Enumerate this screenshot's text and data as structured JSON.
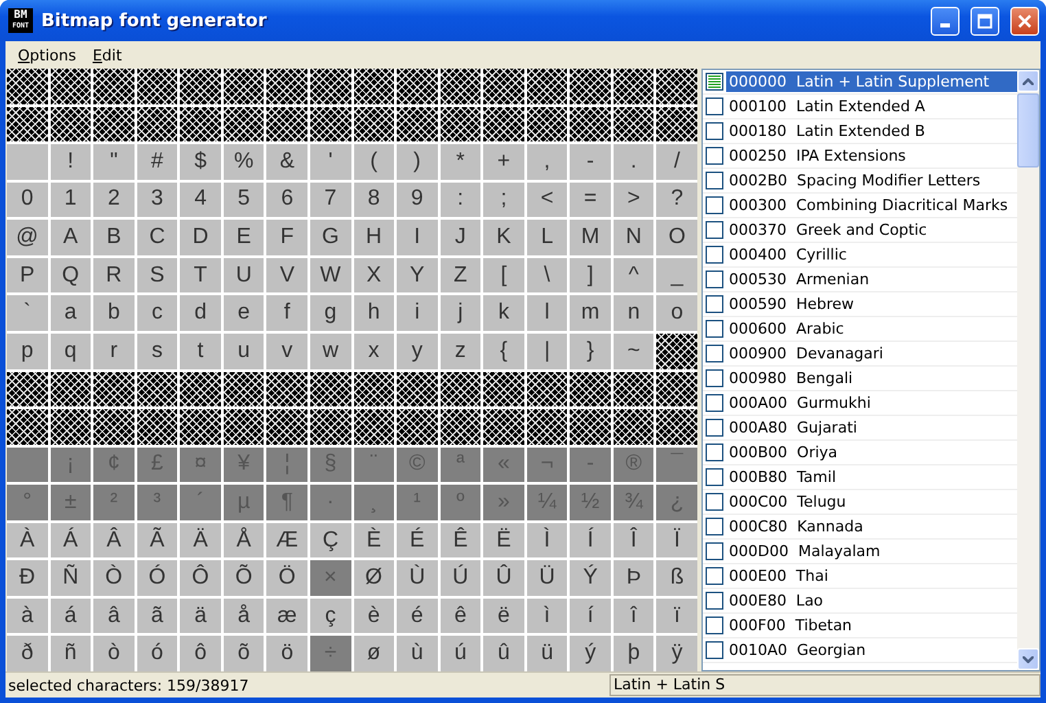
{
  "window": {
    "title": "Bitmap font generator",
    "icon_text": [
      "BM",
      "FONT"
    ]
  },
  "menu": [
    "Options",
    "Edit"
  ],
  "grid": {
    "rows": [
      [
        {
          "kind": "empty"
        },
        {
          "kind": "empty"
        },
        {
          "kind": "empty"
        },
        {
          "kind": "empty"
        },
        {
          "kind": "empty"
        },
        {
          "kind": "empty"
        },
        {
          "kind": "empty"
        },
        {
          "kind": "empty"
        },
        {
          "kind": "empty"
        },
        {
          "kind": "empty"
        },
        {
          "kind": "empty"
        },
        {
          "kind": "empty"
        },
        {
          "kind": "empty"
        },
        {
          "kind": "empty"
        },
        {
          "kind": "empty"
        },
        {
          "kind": "empty"
        }
      ],
      [
        {
          "kind": "empty"
        },
        {
          "kind": "empty"
        },
        {
          "kind": "empty"
        },
        {
          "kind": "empty"
        },
        {
          "kind": "empty"
        },
        {
          "kind": "empty"
        },
        {
          "kind": "empty"
        },
        {
          "kind": "empty"
        },
        {
          "kind": "empty"
        },
        {
          "kind": "empty"
        },
        {
          "kind": "empty"
        },
        {
          "kind": "empty"
        },
        {
          "kind": "empty"
        },
        {
          "kind": "empty"
        },
        {
          "kind": "empty"
        },
        {
          "kind": "empty"
        }
      ],
      [
        {
          "kind": "glyph",
          "selected": true
        },
        {
          "kind": "glyph",
          "char": "!",
          "selected": true
        },
        {
          "kind": "glyph",
          "char": "\"",
          "selected": true
        },
        {
          "kind": "glyph",
          "char": "#",
          "selected": true
        },
        {
          "kind": "glyph",
          "char": "$",
          "selected": true
        },
        {
          "kind": "glyph",
          "char": "%",
          "selected": true
        },
        {
          "kind": "glyph",
          "char": "&",
          "selected": true
        },
        {
          "kind": "glyph",
          "char": "'",
          "selected": true
        },
        {
          "kind": "glyph",
          "char": "(",
          "selected": true
        },
        {
          "kind": "glyph",
          "char": ")",
          "selected": true
        },
        {
          "kind": "glyph",
          "char": "*",
          "selected": true
        },
        {
          "kind": "glyph",
          "char": "+",
          "selected": true
        },
        {
          "kind": "glyph",
          "char": ",",
          "selected": true
        },
        {
          "kind": "glyph",
          "char": "-",
          "selected": true
        },
        {
          "kind": "glyph",
          "char": ".",
          "selected": true
        },
        {
          "kind": "glyph",
          "char": "/",
          "selected": true
        }
      ],
      [
        {
          "kind": "glyph",
          "char": "0",
          "selected": true
        },
        {
          "kind": "glyph",
          "char": "1",
          "selected": true
        },
        {
          "kind": "glyph",
          "char": "2",
          "selected": true
        },
        {
          "kind": "glyph",
          "char": "3",
          "selected": true
        },
        {
          "kind": "glyph",
          "char": "4",
          "selected": true
        },
        {
          "kind": "glyph",
          "char": "5",
          "selected": true
        },
        {
          "kind": "glyph",
          "char": "6",
          "selected": true
        },
        {
          "kind": "glyph",
          "char": "7",
          "selected": true
        },
        {
          "kind": "glyph",
          "char": "8",
          "selected": true
        },
        {
          "kind": "glyph",
          "char": "9",
          "selected": true
        },
        {
          "kind": "glyph",
          "char": ":",
          "selected": true
        },
        {
          "kind": "glyph",
          "char": ";",
          "selected": true
        },
        {
          "kind": "glyph",
          "char": "<",
          "selected": true
        },
        {
          "kind": "glyph",
          "char": "=",
          "selected": true
        },
        {
          "kind": "glyph",
          "char": ">",
          "selected": true
        },
        {
          "kind": "glyph",
          "char": "?",
          "selected": true
        }
      ],
      [
        {
          "kind": "glyph",
          "char": "@",
          "selected": true
        },
        {
          "kind": "glyph",
          "char": "A",
          "selected": true
        },
        {
          "kind": "glyph",
          "char": "B",
          "selected": true
        },
        {
          "kind": "glyph",
          "char": "C",
          "selected": true
        },
        {
          "kind": "glyph",
          "char": "D",
          "selected": true
        },
        {
          "kind": "glyph",
          "char": "E",
          "selected": true
        },
        {
          "kind": "glyph",
          "char": "F",
          "selected": true
        },
        {
          "kind": "glyph",
          "char": "G",
          "selected": true
        },
        {
          "kind": "glyph",
          "char": "H",
          "selected": true
        },
        {
          "kind": "glyph",
          "char": "I",
          "selected": true
        },
        {
          "kind": "glyph",
          "char": "J",
          "selected": true
        },
        {
          "kind": "glyph",
          "char": "K",
          "selected": true
        },
        {
          "kind": "glyph",
          "char": "L",
          "selected": true
        },
        {
          "kind": "glyph",
          "char": "M",
          "selected": true
        },
        {
          "kind": "glyph",
          "char": "N",
          "selected": true
        },
        {
          "kind": "glyph",
          "char": "O",
          "selected": true
        }
      ],
      [
        {
          "kind": "glyph",
          "char": "P",
          "selected": true
        },
        {
          "kind": "glyph",
          "char": "Q",
          "selected": true
        },
        {
          "kind": "glyph",
          "char": "R",
          "selected": true
        },
        {
          "kind": "glyph",
          "char": "S",
          "selected": true
        },
        {
          "kind": "glyph",
          "char": "T",
          "selected": true
        },
        {
          "kind": "glyph",
          "char": "U",
          "selected": true
        },
        {
          "kind": "glyph",
          "char": "V",
          "selected": true
        },
        {
          "kind": "glyph",
          "char": "W",
          "selected": true
        },
        {
          "kind": "glyph",
          "char": "X",
          "selected": true
        },
        {
          "kind": "glyph",
          "char": "Y",
          "selected": true
        },
        {
          "kind": "glyph",
          "char": "Z",
          "selected": true
        },
        {
          "kind": "glyph",
          "char": "[",
          "selected": true
        },
        {
          "kind": "glyph",
          "char": "\\",
          "selected": true
        },
        {
          "kind": "glyph",
          "char": "]",
          "selected": true
        },
        {
          "kind": "glyph",
          "char": "^",
          "selected": true
        },
        {
          "kind": "glyph",
          "char": "_",
          "selected": true
        }
      ],
      [
        {
          "kind": "glyph",
          "char": "`",
          "selected": true
        },
        {
          "kind": "glyph",
          "char": "a",
          "selected": true
        },
        {
          "kind": "glyph",
          "char": "b",
          "selected": true
        },
        {
          "kind": "glyph",
          "char": "c",
          "selected": true
        },
        {
          "kind": "glyph",
          "char": "d",
          "selected": true
        },
        {
          "kind": "glyph",
          "char": "e",
          "selected": true
        },
        {
          "kind": "glyph",
          "char": "f",
          "selected": true
        },
        {
          "kind": "glyph",
          "char": "g",
          "selected": true
        },
        {
          "kind": "glyph",
          "char": "h",
          "selected": true
        },
        {
          "kind": "glyph",
          "char": "i",
          "selected": true
        },
        {
          "kind": "glyph",
          "char": "j",
          "selected": true
        },
        {
          "kind": "glyph",
          "char": "k",
          "selected": true
        },
        {
          "kind": "glyph",
          "char": "l",
          "selected": true
        },
        {
          "kind": "glyph",
          "char": "m",
          "selected": true
        },
        {
          "kind": "glyph",
          "char": "n",
          "selected": true
        },
        {
          "kind": "glyph",
          "char": "o",
          "selected": true
        }
      ],
      [
        {
          "kind": "glyph",
          "char": "p",
          "selected": true
        },
        {
          "kind": "glyph",
          "char": "q",
          "selected": true
        },
        {
          "kind": "glyph",
          "char": "r",
          "selected": true
        },
        {
          "kind": "glyph",
          "char": "s",
          "selected": true
        },
        {
          "kind": "glyph",
          "char": "t",
          "selected": true
        },
        {
          "kind": "glyph",
          "char": "u",
          "selected": true
        },
        {
          "kind": "glyph",
          "char": "v",
          "selected": true
        },
        {
          "kind": "glyph",
          "char": "w",
          "selected": true
        },
        {
          "kind": "glyph",
          "char": "x",
          "selected": true
        },
        {
          "kind": "glyph",
          "char": "y",
          "selected": true
        },
        {
          "kind": "glyph",
          "char": "z",
          "selected": true
        },
        {
          "kind": "glyph",
          "char": "{",
          "selected": true
        },
        {
          "kind": "glyph",
          "char": "|",
          "selected": true
        },
        {
          "kind": "glyph",
          "char": "}",
          "selected": true
        },
        {
          "kind": "glyph",
          "char": "~",
          "selected": true
        },
        {
          "kind": "empty"
        }
      ],
      [
        {
          "kind": "empty"
        },
        {
          "kind": "empty"
        },
        {
          "kind": "empty"
        },
        {
          "kind": "empty"
        },
        {
          "kind": "empty"
        },
        {
          "kind": "empty"
        },
        {
          "kind": "empty"
        },
        {
          "kind": "empty"
        },
        {
          "kind": "empty"
        },
        {
          "kind": "empty"
        },
        {
          "kind": "empty"
        },
        {
          "kind": "empty"
        },
        {
          "kind": "empty"
        },
        {
          "kind": "empty"
        },
        {
          "kind": "empty"
        },
        {
          "kind": "empty"
        }
      ],
      [
        {
          "kind": "empty"
        },
        {
          "kind": "empty"
        },
        {
          "kind": "empty"
        },
        {
          "kind": "empty"
        },
        {
          "kind": "empty"
        },
        {
          "kind": "empty"
        },
        {
          "kind": "empty"
        },
        {
          "kind": "empty"
        },
        {
          "kind": "empty"
        },
        {
          "kind": "empty"
        },
        {
          "kind": "empty"
        },
        {
          "kind": "empty"
        },
        {
          "kind": "empty"
        },
        {
          "kind": "empty"
        },
        {
          "kind": "empty"
        },
        {
          "kind": "empty"
        }
      ],
      [
        {
          "kind": "glyph",
          "selected": false
        },
        {
          "kind": "glyph",
          "char": "¡",
          "selected": false
        },
        {
          "kind": "glyph",
          "char": "¢",
          "selected": false
        },
        {
          "kind": "glyph",
          "char": "£",
          "selected": false
        },
        {
          "kind": "glyph",
          "char": "¤",
          "selected": false
        },
        {
          "kind": "glyph",
          "char": "¥",
          "selected": false
        },
        {
          "kind": "glyph",
          "char": "¦",
          "selected": false
        },
        {
          "kind": "glyph",
          "char": "§",
          "selected": false
        },
        {
          "kind": "glyph",
          "char": "¨",
          "selected": false
        },
        {
          "kind": "glyph",
          "char": "©",
          "selected": false
        },
        {
          "kind": "glyph",
          "char": "ª",
          "selected": false
        },
        {
          "kind": "glyph",
          "char": "«",
          "selected": false
        },
        {
          "kind": "glyph",
          "char": "¬",
          "selected": false
        },
        {
          "kind": "glyph",
          "char": "-",
          "selected": false
        },
        {
          "kind": "glyph",
          "char": "®",
          "selected": false
        },
        {
          "kind": "glyph",
          "char": "¯",
          "selected": false
        }
      ],
      [
        {
          "kind": "glyph",
          "char": "°",
          "selected": false
        },
        {
          "kind": "glyph",
          "char": "±",
          "selected": false
        },
        {
          "kind": "glyph",
          "char": "²",
          "selected": false
        },
        {
          "kind": "glyph",
          "char": "³",
          "selected": false
        },
        {
          "kind": "glyph",
          "char": "´",
          "selected": false
        },
        {
          "kind": "glyph",
          "char": "µ",
          "selected": false
        },
        {
          "kind": "glyph",
          "char": "¶",
          "selected": false
        },
        {
          "kind": "glyph",
          "char": "·",
          "selected": false
        },
        {
          "kind": "glyph",
          "char": "¸",
          "selected": false
        },
        {
          "kind": "glyph",
          "char": "¹",
          "selected": false
        },
        {
          "kind": "glyph",
          "char": "º",
          "selected": false
        },
        {
          "kind": "glyph",
          "char": "»",
          "selected": false
        },
        {
          "kind": "glyph",
          "char": "¼",
          "selected": false
        },
        {
          "kind": "glyph",
          "char": "½",
          "selected": false
        },
        {
          "kind": "glyph",
          "char": "¾",
          "selected": false
        },
        {
          "kind": "glyph",
          "char": "¿",
          "selected": false
        }
      ],
      [
        {
          "kind": "glyph",
          "char": "À",
          "selected": true
        },
        {
          "kind": "glyph",
          "char": "Á",
          "selected": true
        },
        {
          "kind": "glyph",
          "char": "Â",
          "selected": true
        },
        {
          "kind": "glyph",
          "char": "Ã",
          "selected": true
        },
        {
          "kind": "glyph",
          "char": "Ä",
          "selected": true
        },
        {
          "kind": "glyph",
          "char": "Å",
          "selected": true
        },
        {
          "kind": "glyph",
          "char": "Æ",
          "selected": true
        },
        {
          "kind": "glyph",
          "char": "Ç",
          "selected": true
        },
        {
          "kind": "glyph",
          "char": "È",
          "selected": true
        },
        {
          "kind": "glyph",
          "char": "É",
          "selected": true
        },
        {
          "kind": "glyph",
          "char": "Ê",
          "selected": true
        },
        {
          "kind": "glyph",
          "char": "Ë",
          "selected": true
        },
        {
          "kind": "glyph",
          "char": "Ì",
          "selected": true
        },
        {
          "kind": "glyph",
          "char": "Í",
          "selected": true
        },
        {
          "kind": "glyph",
          "char": "Î",
          "selected": true
        },
        {
          "kind": "glyph",
          "char": "Ï",
          "selected": true
        }
      ],
      [
        {
          "kind": "glyph",
          "char": "Ð",
          "selected": true
        },
        {
          "kind": "glyph",
          "char": "Ñ",
          "selected": true
        },
        {
          "kind": "glyph",
          "char": "Ò",
          "selected": true
        },
        {
          "kind": "glyph",
          "char": "Ó",
          "selected": true
        },
        {
          "kind": "glyph",
          "char": "Ô",
          "selected": true
        },
        {
          "kind": "glyph",
          "char": "Õ",
          "selected": true
        },
        {
          "kind": "glyph",
          "char": "Ö",
          "selected": true
        },
        {
          "kind": "glyph",
          "char": "×",
          "selected": false
        },
        {
          "kind": "glyph",
          "char": "Ø",
          "selected": true
        },
        {
          "kind": "glyph",
          "char": "Ù",
          "selected": true
        },
        {
          "kind": "glyph",
          "char": "Ú",
          "selected": true
        },
        {
          "kind": "glyph",
          "char": "Û",
          "selected": true
        },
        {
          "kind": "glyph",
          "char": "Ü",
          "selected": true
        },
        {
          "kind": "glyph",
          "char": "Ý",
          "selected": true
        },
        {
          "kind": "glyph",
          "char": "Þ",
          "selected": true
        },
        {
          "kind": "glyph",
          "char": "ß",
          "selected": true
        }
      ],
      [
        {
          "kind": "glyph",
          "char": "à",
          "selected": true
        },
        {
          "kind": "glyph",
          "char": "á",
          "selected": true
        },
        {
          "kind": "glyph",
          "char": "â",
          "selected": true
        },
        {
          "kind": "glyph",
          "char": "ã",
          "selected": true
        },
        {
          "kind": "glyph",
          "char": "ä",
          "selected": true
        },
        {
          "kind": "glyph",
          "char": "å",
          "selected": true
        },
        {
          "kind": "glyph",
          "char": "æ",
          "selected": true
        },
        {
          "kind": "glyph",
          "char": "ç",
          "selected": true
        },
        {
          "kind": "glyph",
          "char": "è",
          "selected": true
        },
        {
          "kind": "glyph",
          "char": "é",
          "selected": true
        },
        {
          "kind": "glyph",
          "char": "ê",
          "selected": true
        },
        {
          "kind": "glyph",
          "char": "ë",
          "selected": true
        },
        {
          "kind": "glyph",
          "char": "ì",
          "selected": true
        },
        {
          "kind": "glyph",
          "char": "í",
          "selected": true
        },
        {
          "kind": "glyph",
          "char": "î",
          "selected": true
        },
        {
          "kind": "glyph",
          "char": "ï",
          "selected": true
        }
      ],
      [
        {
          "kind": "glyph",
          "char": "ð",
          "selected": true
        },
        {
          "kind": "glyph",
          "char": "ñ",
          "selected": true
        },
        {
          "kind": "glyph",
          "char": "ò",
          "selected": true
        },
        {
          "kind": "glyph",
          "char": "ó",
          "selected": true
        },
        {
          "kind": "glyph",
          "char": "ô",
          "selected": true
        },
        {
          "kind": "glyph",
          "char": "õ",
          "selected": true
        },
        {
          "kind": "glyph",
          "char": "ö",
          "selected": true
        },
        {
          "kind": "glyph",
          "char": "÷",
          "selected": false
        },
        {
          "kind": "glyph",
          "char": "ø",
          "selected": true
        },
        {
          "kind": "glyph",
          "char": "ù",
          "selected": true
        },
        {
          "kind": "glyph",
          "char": "ú",
          "selected": true
        },
        {
          "kind": "glyph",
          "char": "û",
          "selected": true
        },
        {
          "kind": "glyph",
          "char": "ü",
          "selected": true
        },
        {
          "kind": "glyph",
          "char": "ý",
          "selected": true
        },
        {
          "kind": "glyph",
          "char": "þ",
          "selected": true
        },
        {
          "kind": "glyph",
          "char": "ÿ",
          "selected": true
        }
      ]
    ]
  },
  "ranges": [
    {
      "label": "000000  Latin + Latin Supplement",
      "checked": true,
      "selected": true
    },
    {
      "label": "000100  Latin Extended A",
      "checked": false,
      "selected": false
    },
    {
      "label": "000180  Latin Extended B",
      "checked": false,
      "selected": false
    },
    {
      "label": "000250  IPA Extensions",
      "checked": false,
      "selected": false
    },
    {
      "label": "0002B0  Spacing Modifier Letters",
      "checked": false,
      "selected": false
    },
    {
      "label": "000300  Combining Diacritical Marks",
      "checked": false,
      "selected": false
    },
    {
      "label": "000370  Greek and Coptic",
      "checked": false,
      "selected": false
    },
    {
      "label": "000400  Cyrillic",
      "checked": false,
      "selected": false
    },
    {
      "label": "000530  Armenian",
      "checked": false,
      "selected": false
    },
    {
      "label": "000590  Hebrew",
      "checked": false,
      "selected": false
    },
    {
      "label": "000600  Arabic",
      "checked": false,
      "selected": false
    },
    {
      "label": "000900  Devanagari",
      "checked": false,
      "selected": false
    },
    {
      "label": "000980  Bengali",
      "checked": false,
      "selected": false
    },
    {
      "label": "000A00  Gurmukhi",
      "checked": false,
      "selected": false
    },
    {
      "label": "000A80  Gujarati",
      "checked": false,
      "selected": false
    },
    {
      "label": "000B00  Oriya",
      "checked": false,
      "selected": false
    },
    {
      "label": "000B80  Tamil",
      "checked": false,
      "selected": false
    },
    {
      "label": "000C00  Telugu",
      "checked": false,
      "selected": false
    },
    {
      "label": "000C80  Kannada",
      "checked": false,
      "selected": false
    },
    {
      "label": "000D00  Malayalam",
      "checked": false,
      "selected": false
    },
    {
      "label": "000E00  Thai",
      "checked": false,
      "selected": false
    },
    {
      "label": "000E80  Lao",
      "checked": false,
      "selected": false
    },
    {
      "label": "000F00  Tibetan",
      "checked": false,
      "selected": false
    },
    {
      "label": "0010A0  Georgian",
      "checked": false,
      "selected": false
    }
  ],
  "status_bar": {
    "left": "selected characters: 159/38917",
    "right": "Latin + Latin S"
  }
}
